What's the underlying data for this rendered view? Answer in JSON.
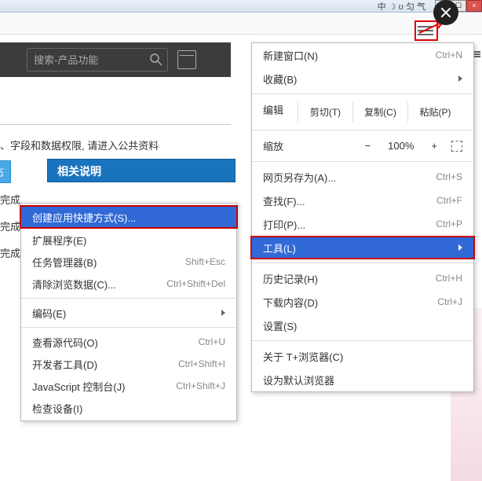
{
  "titlebar": {
    "ime": "中 ☽ ʊ 匀 气"
  },
  "search": {
    "placeholder": "搜索-产品功能"
  },
  "page": {
    "notice": "、字段和数据权限, 请进入公共资料",
    "status_tab": "状态",
    "desc_header": "相关说明",
    "rows": [
      "完成",
      "完成",
      "完成"
    ]
  },
  "main_menu": {
    "new_window": "新建窗口(N)",
    "new_window_sc": "Ctrl+N",
    "favorites": "收藏(B)",
    "edit": "编辑",
    "cut": "剪切(T)",
    "copy": "复制(C)",
    "paste": "粘贴(P)",
    "zoom": "缩放",
    "zoom_val": "100%",
    "save_as": "网页另存为(A)...",
    "save_as_sc": "Ctrl+S",
    "find": "查找(F)...",
    "find_sc": "Ctrl+F",
    "print": "打印(P)...",
    "print_sc": "Ctrl+P",
    "tools": "工具(L)",
    "history": "历史记录(H)",
    "history_sc": "Ctrl+H",
    "downloads": "下载内容(D)",
    "downloads_sc": "Ctrl+J",
    "settings": "设置(S)",
    "about": "关于 T+浏览器(C)",
    "default": "设为默认浏览器"
  },
  "sub_menu": {
    "create_shortcut": "创建应用快捷方式(S)...",
    "extensions": "扩展程序(E)",
    "task_mgr": "任务管理器(B)",
    "task_mgr_sc": "Shift+Esc",
    "clear_data": "清除浏览数据(C)...",
    "clear_data_sc": "Ctrl+Shift+Del",
    "encoding": "编码(E)",
    "view_src": "查看源代码(O)",
    "view_src_sc": "Ctrl+U",
    "dev_tools": "开发者工具(D)",
    "dev_tools_sc": "Ctrl+Shift+I",
    "js_console": "JavaScript 控制台(J)",
    "js_console_sc": "Ctrl+Shift+J",
    "inspect": "检查设备(I)"
  }
}
